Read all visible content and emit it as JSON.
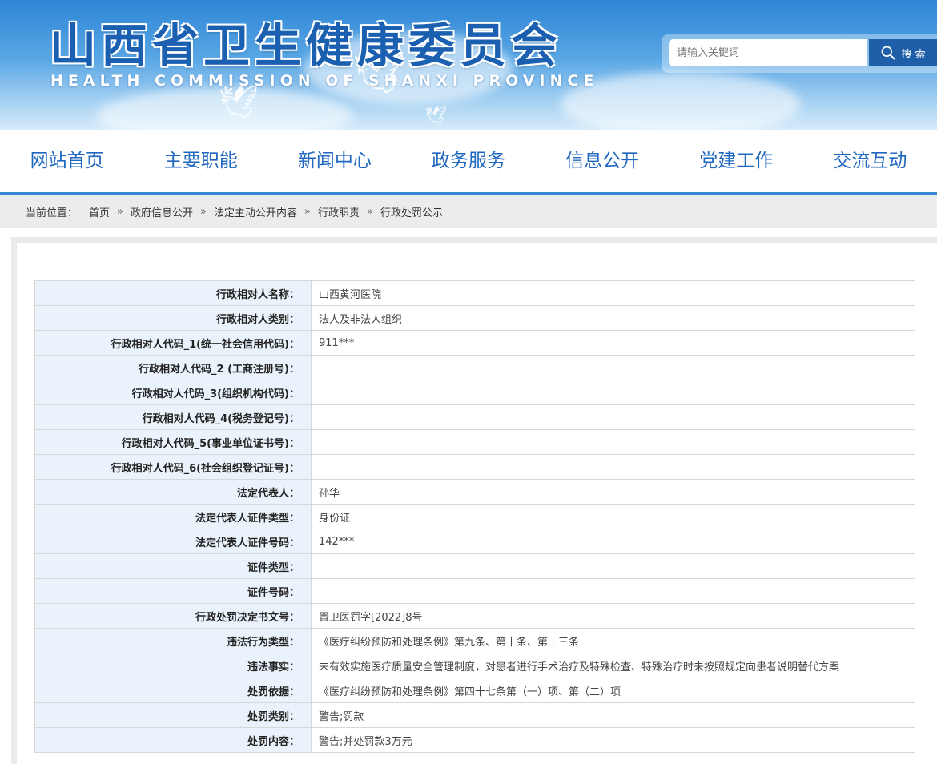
{
  "header": {
    "title": "山西省卫生健康委员会",
    "subtitle": "HEALTH COMMISSION OF SHANXI PROVINCE",
    "search": {
      "placeholder": "请输入关键词",
      "button_label": "搜 索"
    }
  },
  "nav": {
    "items": [
      "网站首页",
      "主要职能",
      "新闻中心",
      "政务服务",
      "信息公开",
      "党建工作",
      "交流互动"
    ]
  },
  "breadcrumb": {
    "label": "当前位置：",
    "items": [
      "首页",
      "政府信息公开",
      "法定主动公开内容",
      "行政职责",
      "行政处罚公示"
    ],
    "separator": "»"
  },
  "record": [
    {
      "key": "行政相对人名称：",
      "value": "山西黄河医院"
    },
    {
      "key": "行政相对人类别：",
      "value": "法人及非法人组织"
    },
    {
      "key": "行政相对人代码_1(统一社会信用代码)：",
      "value": "911***"
    },
    {
      "key": "行政相对人代码_2 (工商注册号)：",
      "value": ""
    },
    {
      "key": "行政相对人代码_3(组织机构代码)：",
      "value": ""
    },
    {
      "key": "行政相对人代码_4(税务登记号)：",
      "value": ""
    },
    {
      "key": "行政相对人代码_5(事业单位证书号)：",
      "value": ""
    },
    {
      "key": "行政相对人代码_6(社会组织登记证号)：",
      "value": ""
    },
    {
      "key": "法定代表人：",
      "value": "孙华"
    },
    {
      "key": "法定代表人证件类型：",
      "value": "身份证"
    },
    {
      "key": "法定代表人证件号码：",
      "value": "142***"
    },
    {
      "key": "证件类型：",
      "value": ""
    },
    {
      "key": "证件号码：",
      "value": ""
    },
    {
      "key": "行政处罚决定书文号：",
      "value": "晋卫医罚字[2022]8号"
    },
    {
      "key": "违法行为类型：",
      "value": "《医疗纠纷预防和处理条例》第九条、第十条、第十三条"
    },
    {
      "key": "违法事实：",
      "value": "未有效实施医疗质量安全管理制度，对患者进行手术治疗及特殊检查、特殊治疗时未按照规定向患者说明替代方案"
    },
    {
      "key": "处罚依据：",
      "value": "《医疗纠纷预防和处理条例》第四十七条第（一）项、第（二）项"
    },
    {
      "key": "处罚类别：",
      "value": "警告;罚款"
    },
    {
      "key": "处罚内容：",
      "value": "警告;并处罚款3万元"
    }
  ],
  "colors": {
    "nav_text": "#1f67bf",
    "search_button": "#1f5ea8",
    "key_cell_bg": "#eaf3fb",
    "nav_border": "#3a86d6"
  }
}
